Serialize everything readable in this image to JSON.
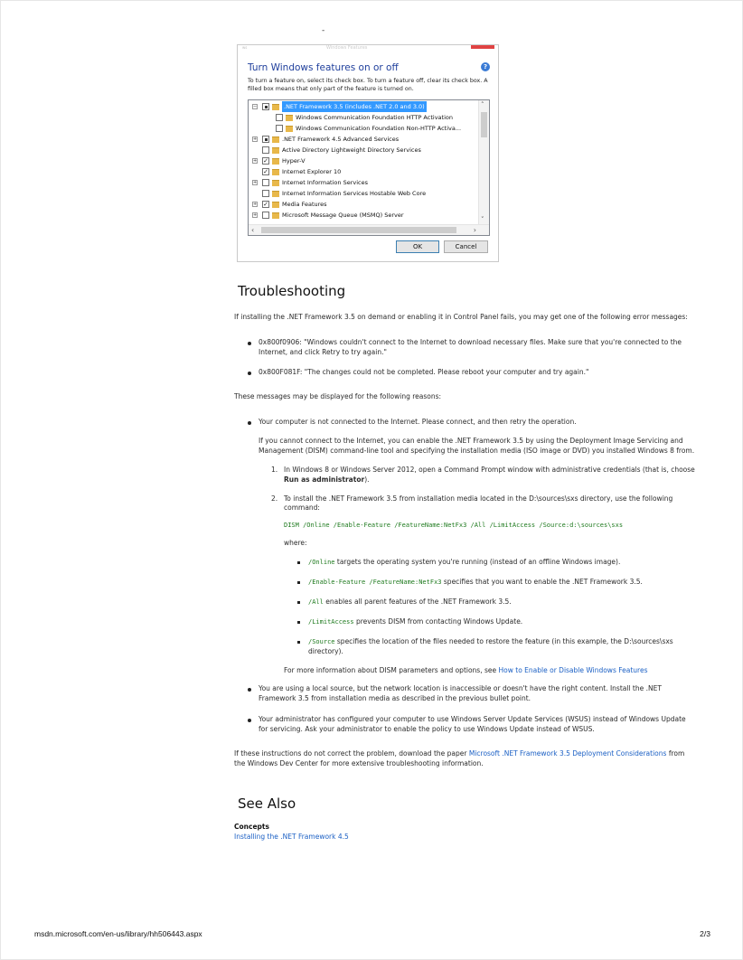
{
  "header_dash": "-",
  "dialog": {
    "app_name": "ws",
    "window_title": "Windows Features",
    "heading": "Turn Windows features on or off",
    "help_icon": "?",
    "description": "To turn a feature on, select its check box. To turn a feature off, clear its check box. A filled box means that only part of the feature is turned on.",
    "features": [
      {
        "label": ".NET Framework 3.5 (includes .NET 2.0 and 3.0)",
        "state": "partial",
        "expander": "−",
        "selected": true
      },
      {
        "label": "Windows Communication Foundation HTTP Activation",
        "state": "unchecked",
        "expander": ""
      },
      {
        "label": "Windows Communication Foundation Non-HTTP Activa...",
        "state": "unchecked",
        "expander": ""
      },
      {
        "label": ".NET Framework 4.5 Advanced Services",
        "state": "partial",
        "expander": "+"
      },
      {
        "label": "Active Directory Lightweight Directory Services",
        "state": "unchecked",
        "expander": ""
      },
      {
        "label": "Hyper-V",
        "state": "checked",
        "expander": "+"
      },
      {
        "label": "Internet Explorer 10",
        "state": "checked",
        "expander": ""
      },
      {
        "label": "Internet Information Services",
        "state": "unchecked",
        "expander": "+"
      },
      {
        "label": "Internet Information Services Hostable Web Core",
        "state": "unchecked",
        "expander": ""
      },
      {
        "label": "Media Features",
        "state": "checked",
        "expander": "+"
      },
      {
        "label": "Microsoft Message Queue (MSMQ) Server",
        "state": "unchecked",
        "expander": "+"
      }
    ],
    "ok_label": "OK",
    "cancel_label": "Cancel"
  },
  "troubleshooting": {
    "heading": "Troubleshooting",
    "intro": "If installing the .NET Framework 3.5 on demand or enabling it in Control Panel fails, you may get one of the following error messages:",
    "errors": [
      "0x800f0906: \"Windows couldn't connect to the Internet to download necessary files. Make sure that you're connected to the Internet, and click Retry to try again.\"",
      "0x800F081F: \"The changes could not be completed. Please reboot your computer and try again.\""
    ],
    "reasons_intro": "These messages may be displayed for the following reasons:",
    "reason1": "Your computer is not connected to the Internet. Please connect, and then retry the operation.",
    "reason1_detail": "If you cannot connect to the Internet, you can enable the .NET Framework 3.5 by using the Deployment Image Servicing and Management (DISM) command-line tool and specifying the installation media (ISO image or DVD) you installed Windows 8 from.",
    "step1_num": "1.",
    "step1_pre": "In Windows 8 or Windows Server 2012, open a Command Prompt window with administrative credentials (that is, choose ",
    "step1_bold": "Run as administrator",
    "step1_post": ").",
    "step2_num": "2.",
    "step2": "To install the .NET Framework 3.5 from installation media located in the D:\\sources\\sxs directory, use the following command:",
    "command": "DISM /Online /Enable-Feature /FeatureName:NetFx3 /All /LimitAccess /Source:d:\\sources\\sxs",
    "where": "where:",
    "params": [
      {
        "code": "/Online",
        "text": " targets the operating system you're running (instead of an offline Windows image)."
      },
      {
        "code": "/Enable-Feature /FeatureName:NetFx3",
        "text": " specifies that you want to enable the .NET Framework 3.5."
      },
      {
        "code": "/All",
        "text": " enables all parent features of the .NET Framework 3.5."
      },
      {
        "code": "/LimitAccess",
        "text": " prevents DISM from contacting Windows Update."
      },
      {
        "code": "/Source",
        "text": " specifies the location of the files needed to restore the feature (in this example, the D:\\sources\\sxs directory)."
      }
    ],
    "more_info_pre": "For more information about DISM parameters and options, see ",
    "more_info_link": "How to Enable or Disable Windows Features",
    "reason2": "You are using a local source, but the network location is inaccessible or doesn't have the right content. Install the .NET Framework 3.5 from installation media as described in the previous bullet point.",
    "reason3": "Your administrator has configured your computer to use Windows Server Update Services (WSUS) instead of Windows Update for servicing. Ask your administrator to enable the policy to use Windows Update instead of WSUS.",
    "closing_pre": "If these instructions do not correct the problem, download the paper ",
    "closing_link": "Microsoft .NET Framework 3.5 Deployment Considerations",
    "closing_post": " from the Windows Dev Center for more extensive troubleshooting information."
  },
  "see_also": {
    "heading": "See Also",
    "concepts_label": "Concepts",
    "link": "Installing the .NET Framework 4.5"
  },
  "footer": {
    "url": "msdn.microsoft.com/en-us/library/hh506443.aspx",
    "page": "2/3"
  }
}
